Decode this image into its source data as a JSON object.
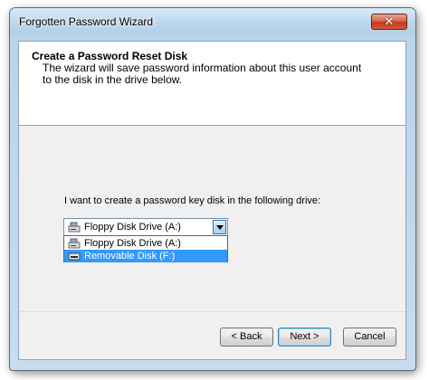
{
  "window": {
    "title": "Forgotten Password Wizard",
    "close_glyph": "✕"
  },
  "header": {
    "title": "Create a Password Reset Disk",
    "description": "The wizard will save password information about this user account to the disk in the drive below."
  },
  "main": {
    "instruction": "I want to create a password key disk in the following drive:",
    "drive_select": {
      "selected_value": "Floppy Disk Drive (A:)",
      "selected_icon": "floppy-drive-icon",
      "options": [
        {
          "label": "Floppy Disk Drive (A:)",
          "icon": "floppy-drive-icon",
          "highlighted": false
        },
        {
          "label": "Removable Disk (F:)",
          "icon": "removable-disk-icon",
          "highlighted": true
        }
      ]
    }
  },
  "buttons": {
    "back": "< Back",
    "next": "Next >",
    "cancel": "Cancel"
  },
  "colors": {
    "highlight": "#3399ff",
    "close_button": "#c2391c",
    "title_bar": "#bcd6ec"
  }
}
